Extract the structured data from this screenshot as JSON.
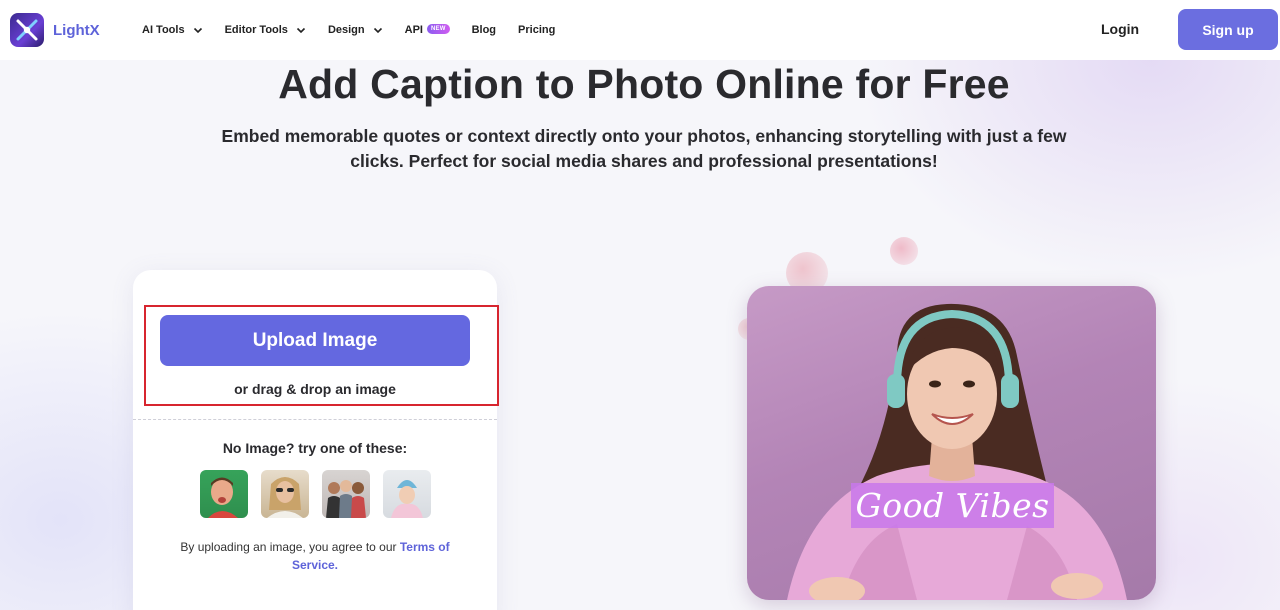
{
  "brand": {
    "name": "LightX",
    "logo_icon": "lightx-logo-icon"
  },
  "nav": {
    "items": [
      {
        "label": "AI Tools",
        "has_dropdown": true
      },
      {
        "label": "Editor Tools",
        "has_dropdown": true
      },
      {
        "label": "Design",
        "has_dropdown": true
      },
      {
        "label": "API",
        "badge": "NEW"
      },
      {
        "label": "Blog"
      },
      {
        "label": "Pricing"
      }
    ],
    "login_label": "Login",
    "signup_label": "Sign up"
  },
  "hero": {
    "title": "Add Caption to Photo Online for Free",
    "subtitle": "Embed memorable quotes or context directly onto your photos, enhancing storytelling with just a few clicks. Perfect for social media shares and professional presentations!"
  },
  "upload": {
    "button_label": "Upload Image",
    "drag_text": "or drag & drop an image",
    "try_text": "No Image? try one of these:",
    "terms_prefix": "By uploading an image, you agree to our ",
    "terms_link": "Terms of Service."
  },
  "preview": {
    "caption": "Good Vibes"
  },
  "colors": {
    "accent": "#6468e0",
    "brand_text": "#5e63d9",
    "highlight": "#d7252f",
    "caption_bg": "#c878eb"
  }
}
